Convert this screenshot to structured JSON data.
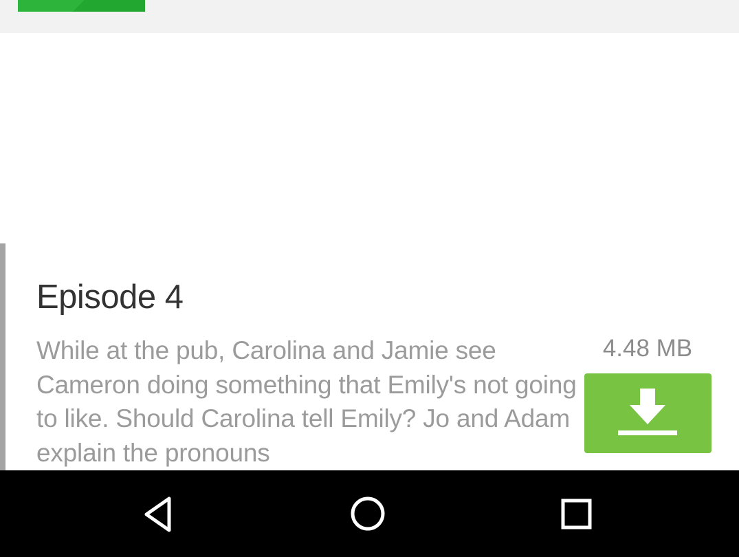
{
  "top_bar": {
    "button_color": "#2cb53a"
  },
  "episode": {
    "title": "Episode 4",
    "description": "While at the pub, Carolina and Jamie see Cameron doing something that Emily's not going to like. Should Carolina tell Emily? Jo and Adam explain the pronouns",
    "file_size": "4.48 MB",
    "download_icon": "download-icon",
    "download_color": "#78c442"
  },
  "nav_bar": {
    "back_icon": "back-triangle-icon",
    "home_icon": "home-circle-icon",
    "recents_icon": "recents-square-icon"
  }
}
